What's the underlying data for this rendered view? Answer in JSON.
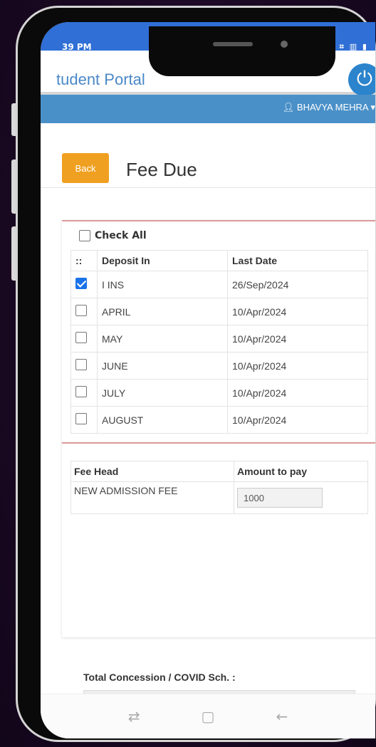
{
  "status": {
    "time": "39 PM",
    "icons": "⊙ ⌗ ▥ ▮"
  },
  "app": {
    "title": "tudent Portal",
    "power_icon": "power-icon"
  },
  "user": {
    "name": "BHAVYA MEHRA",
    "icon": "user-icon"
  },
  "page": {
    "back_label": "Back",
    "title": "Fee Due"
  },
  "due_section": {
    "check_all_label": "Check All",
    "headers": [
      "::",
      "Deposit In",
      "Last Date"
    ],
    "rows": [
      {
        "deposit_in": "I INS",
        "last_date": "26/Sep/2024",
        "checked": true
      },
      {
        "deposit_in": "APRIL",
        "last_date": "10/Apr/2024",
        "checked": false
      },
      {
        "deposit_in": "MAY",
        "last_date": "10/Apr/2024",
        "checked": false
      },
      {
        "deposit_in": "JUNE",
        "last_date": "10/Apr/2024",
        "checked": false
      },
      {
        "deposit_in": "JULY",
        "last_date": "10/Apr/2024",
        "checked": false
      },
      {
        "deposit_in": "AUGUST",
        "last_date": "10/Apr/2024",
        "checked": false
      }
    ]
  },
  "fee_section": {
    "headers": [
      "Fee Head",
      "Amount to pay"
    ],
    "rows": [
      {
        "fee_head": "NEW ADMISSION FEE",
        "amount": "1000"
      }
    ]
  },
  "concession": {
    "label": "Total Concession / COVID Sch. :"
  },
  "navbar": {
    "recent": "⇄",
    "home": "▢",
    "back": "←"
  },
  "colors": {
    "status_bar": "#2f6fd6",
    "user_bar": "#4a90c8",
    "back_button": "#f0a020",
    "checkbox": "#1a73e8"
  }
}
